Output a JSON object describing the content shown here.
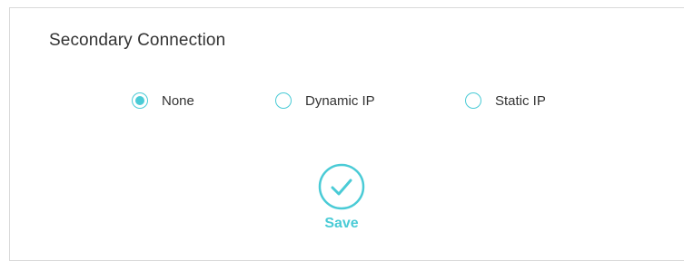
{
  "section": {
    "title": "Secondary Connection"
  },
  "connection_type": {
    "selected": "None",
    "options": [
      {
        "label": "None",
        "checked": true
      },
      {
        "label": "Dynamic IP",
        "checked": false
      },
      {
        "label": "Static IP",
        "checked": false
      }
    ]
  },
  "actions": {
    "save_label": "Save",
    "save_icon": "checkmark-circle-icon"
  },
  "colors": {
    "accent": "#4acbd6",
    "text": "#333333",
    "border": "#d9d9d9"
  }
}
